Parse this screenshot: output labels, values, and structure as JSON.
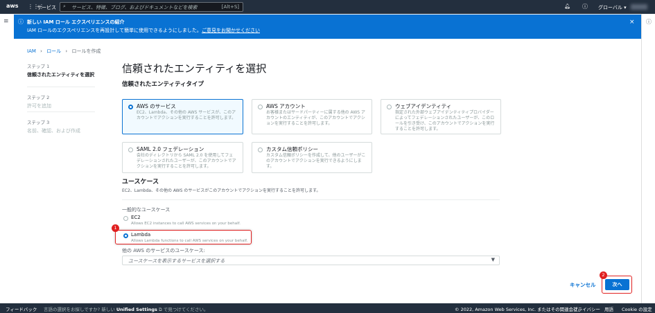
{
  "nav": {
    "logo": "aws",
    "services": "サービス",
    "search_placeholder": "サービス、特徴、ブログ、およびドキュメントなどを検索",
    "shortcut": "[Alt+S]",
    "region": "グローバル ▾"
  },
  "banner": {
    "title": "新しい IAM ロール エクスペリエンスの紹介",
    "text": "IAM ロールのエクスペリエンスを再設計して簡単に使用できるようにしました。",
    "link": "ご意見をお聞かせください"
  },
  "breadcrumb": [
    "IAM",
    "ロール",
    "ロールを作成"
  ],
  "steps": [
    {
      "num": "ステップ 1",
      "label": "信頼されたエンティティを選択"
    },
    {
      "num": "ステップ 2",
      "label": "許可を追加"
    },
    {
      "num": "ステップ 3",
      "label": "名前、確認、および作成"
    }
  ],
  "title": "信頼されたエンティティを選択",
  "entity_type_heading": "信頼されたエンティティタイプ",
  "entity_types": [
    {
      "title": "AWS のサービス",
      "desc": "EC2、Lambda、その他の AWS サービスが、このアカウントでアクションを実行することを許可します。",
      "selected": true
    },
    {
      "title": "AWS アカウント",
      "desc": "お客様またはサードパーティーに属する他の AWS アカウントのエンティティが、このアカウントでアクションを実行することを許可します。",
      "selected": false
    },
    {
      "title": "ウェブアイデンティティ",
      "desc": "指定された外部ウェブアイデンティティプロバイダーによってフェデレーションされたユーザーが、このロールを引き受け、このアカウントでアクションを実行することを許可します。",
      "selected": false
    },
    {
      "title": "SAML 2.0 フェデレーション",
      "desc": "会社のディレクトリから SAML 2.0 を使用してフェデレーションされたユーザーが、このアカウントでアクションを実行することを許可します。",
      "selected": false
    },
    {
      "title": "カスタム信頼ポリシー",
      "desc": "カスタム信頼ポリシーを作成して、他のユーザーがこのアカウントでアクションを実行できるようにします。",
      "selected": false
    }
  ],
  "usecase": {
    "heading": "ユースケース",
    "desc": "EC2、Lambda、その他の AWS のサービスがこのアカウントでアクションを実行することを許可します。",
    "common_label": "一般的なユースケース",
    "options": [
      {
        "title": "EC2",
        "desc": "Allows EC2 instances to call AWS services on your behalf.",
        "selected": false
      },
      {
        "title": "Lambda",
        "desc": "Allows Lambda functions to call AWS services on your behalf.",
        "selected": true
      }
    ],
    "other_label": "他の AWS のサービスのユースケース:",
    "select_placeholder": "ユースケースを表示するサービスを選択する"
  },
  "actions": {
    "cancel": "キャンセル",
    "next": "次へ"
  },
  "badges": [
    "1",
    "2"
  ],
  "footer": {
    "feedback": "フィードバック",
    "lang_pre": "言語の選択をお探しですか? 新しい",
    "unified": "Unified Settings",
    "lang_post": "で見つけてください。",
    "copyright": "© 2022, Amazon Web Services, Inc. またはその関連会社。",
    "privacy": "プライバシー",
    "terms": "用語",
    "cookie": "Cookie の設定"
  },
  "colors": {
    "accent": "#0972d3",
    "nav": "#232f3e",
    "highlight": "#e02020"
  }
}
